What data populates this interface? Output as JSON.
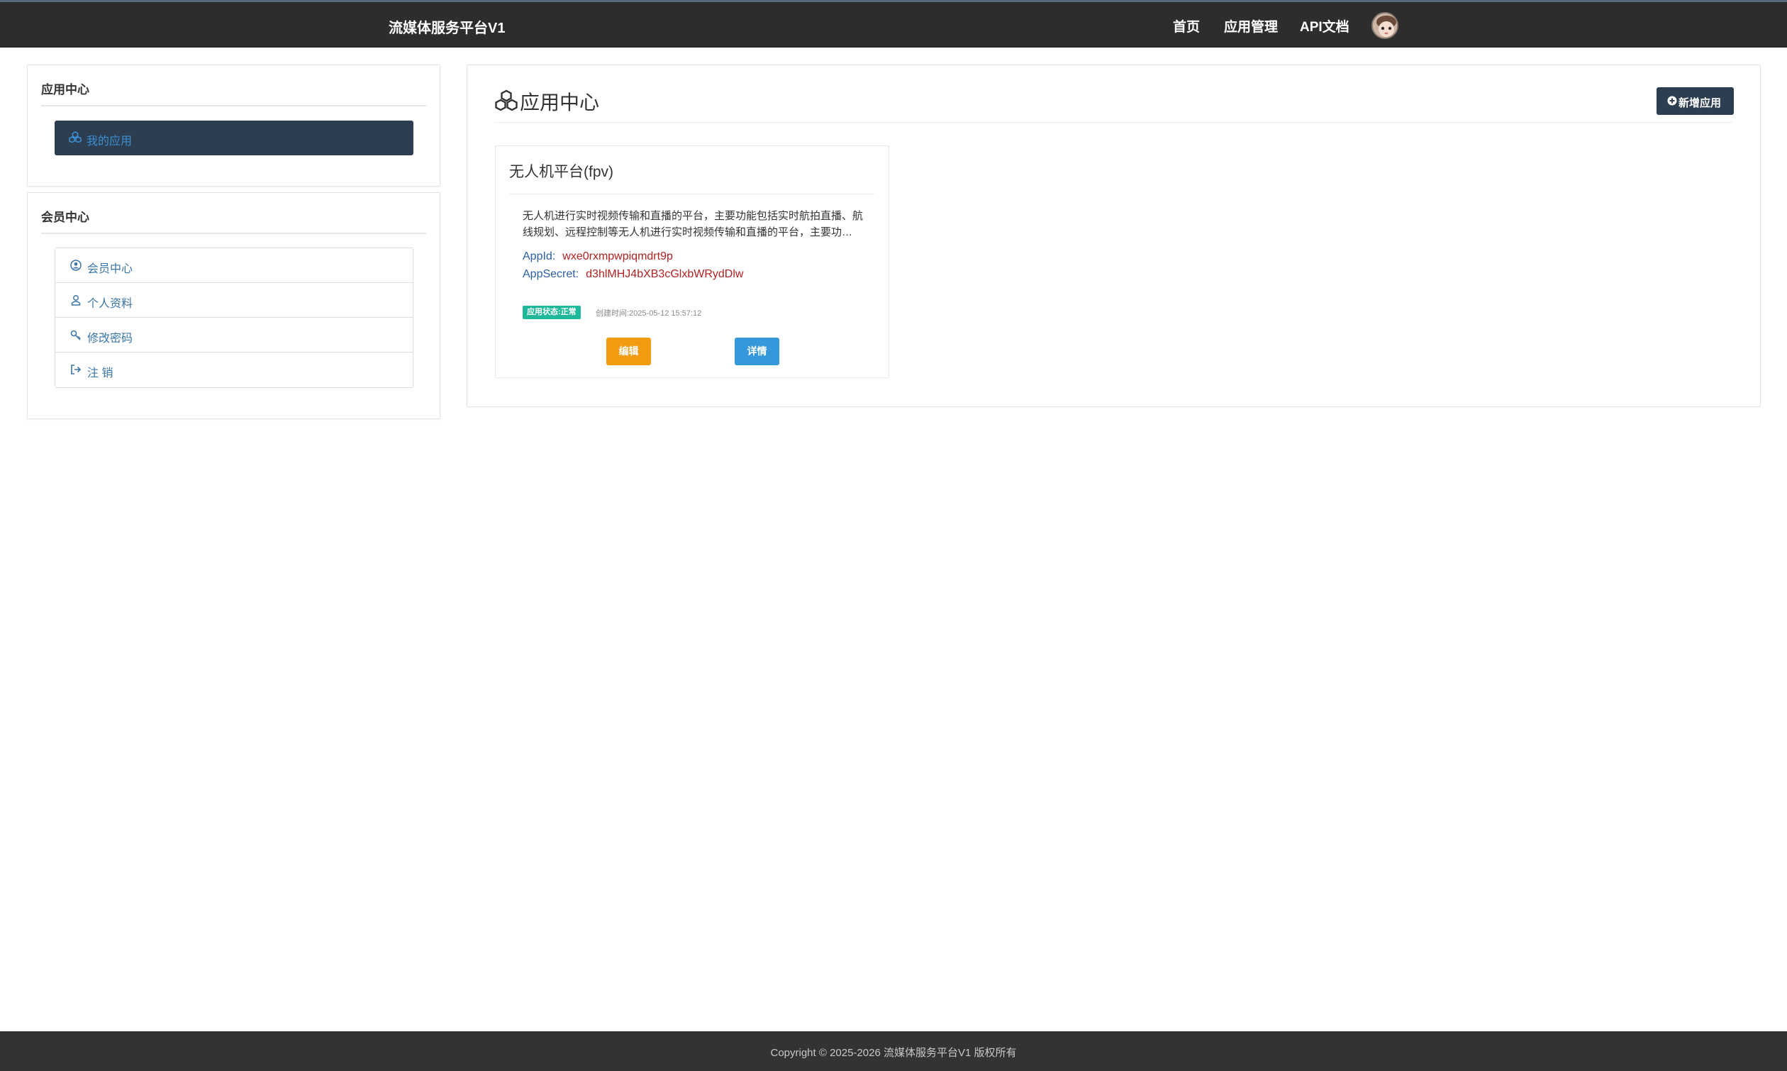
{
  "header": {
    "brand": "流媒体服务平台V1",
    "nav": [
      {
        "label": "首页"
      },
      {
        "label": "应用管理"
      },
      {
        "label": "API文档"
      }
    ],
    "avatar_icon": "user-avatar"
  },
  "sidebar": {
    "app_center": {
      "title": "应用中心",
      "items": [
        {
          "label": "我的应用",
          "icon": "cubes-icon",
          "active": true
        }
      ]
    },
    "member_center": {
      "title": "会员中心",
      "items": [
        {
          "label": "会员中心",
          "icon": "user-circle-icon"
        },
        {
          "label": "个人资料",
          "icon": "user-outline-icon"
        },
        {
          "label": "修改密码",
          "icon": "key-icon"
        },
        {
          "label": "注 销",
          "icon": "sign-out-icon"
        }
      ]
    }
  },
  "main": {
    "title": "应用中心",
    "title_icon": "cubes-icon",
    "add_button_label": "新增应用",
    "add_button_icon": "plus-circle-icon",
    "apps": [
      {
        "name": "无人机平台(fpv)",
        "description": "无人机进行实时视频传输和直播的平台，主要功能包括实时航拍直播、航线规划、远程控制等无人机进行实时视频传输和直播的平台，主要功能包括实时航拍直播、航线规划、远程控制等",
        "appid_label": "AppId:",
        "appid_value": "wxe0rxmpwpiqmdrt9p",
        "appsecret_label": "AppSecret:",
        "appsecret_value": "d3hlMHJ4bXB3cGlxbWRydDlw",
        "status": "应用状态:正常",
        "created": "创建时间:2025-05-12 15:57:12",
        "edit_label": "编辑",
        "detail_label": "详情"
      }
    ]
  },
  "footer": {
    "copyright": "Copyright © 2025-2026 流媒体服务平台V1 版权所有"
  },
  "colors": {
    "navbar_bg": "#2d2d2d",
    "sidebar_active_bg": "#2c3e50",
    "link_blue": "#3a75a8",
    "secret_red": "#b22222",
    "status_green": "#1fb89a",
    "edit_orange": "#f39c12",
    "detail_blue": "#3498db"
  }
}
